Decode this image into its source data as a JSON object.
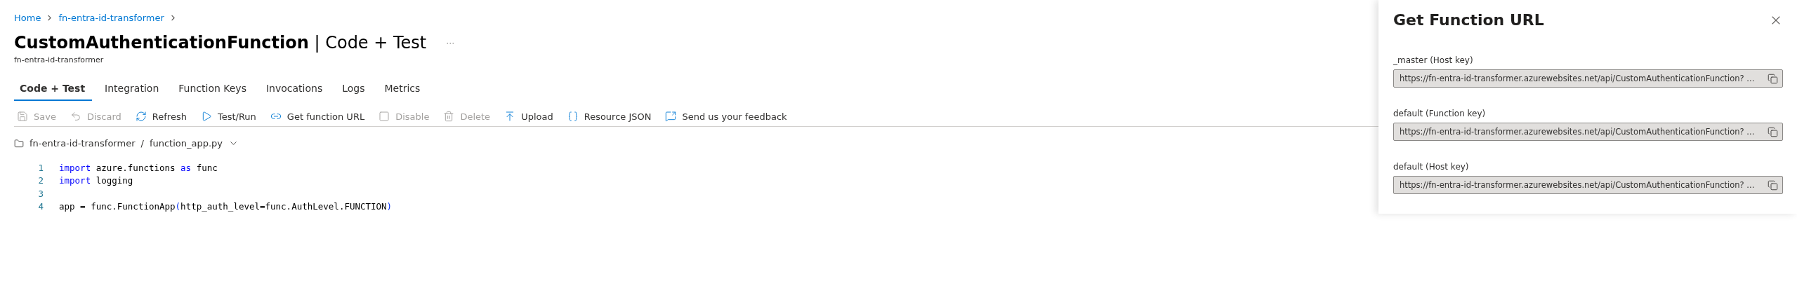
{
  "breadcrumb": [
    {
      "label": "Home"
    },
    {
      "label": "fn-entra-id-transformer"
    }
  ],
  "title": {
    "name": "CustomAuthenticationFunction",
    "separator": "|",
    "section": "Code + Test",
    "more": "···"
  },
  "subtitle": "fn-entra-id-transformer",
  "tabs": [
    {
      "label": "Code + Test",
      "selected": true
    },
    {
      "label": "Integration",
      "selected": false
    },
    {
      "label": "Function Keys",
      "selected": false
    },
    {
      "label": "Invocations",
      "selected": false
    },
    {
      "label": "Logs",
      "selected": false
    },
    {
      "label": "Metrics",
      "selected": false
    }
  ],
  "toolbar": [
    {
      "label": "Save",
      "disabled": true
    },
    {
      "label": "Discard",
      "disabled": true
    },
    {
      "label": "Refresh",
      "disabled": false
    },
    {
      "label": "Test/Run",
      "disabled": false
    },
    {
      "label": "Get function URL",
      "disabled": false
    },
    {
      "label": "Disable",
      "disabled": true
    },
    {
      "label": "Delete",
      "disabled": true
    },
    {
      "label": "Upload",
      "disabled": false
    },
    {
      "label": "Resource JSON",
      "disabled": false
    },
    {
      "label": "Send us your feedback",
      "disabled": false
    }
  ],
  "file_path": {
    "folder": "fn-entra-id-transformer",
    "separator": "/",
    "file": "function_app.py"
  },
  "code": [
    {
      "number": "1",
      "tokens": [
        {
          "kind": "keyword",
          "text": "import"
        },
        {
          "kind": "plain",
          "text": " azure.functions "
        },
        {
          "kind": "keyword",
          "text": "as"
        },
        {
          "kind": "plain",
          "text": " func"
        }
      ]
    },
    {
      "number": "2",
      "tokens": [
        {
          "kind": "keyword",
          "text": "import"
        },
        {
          "kind": "plain",
          "text": " logging"
        }
      ]
    },
    {
      "number": "3"
    },
    {
      "number": "4",
      "tokens": [
        {
          "kind": "plain",
          "text": "app = func.FunctionApp"
        },
        {
          "kind": "paren",
          "text": "("
        },
        {
          "kind": "plain",
          "text": "http_auth_level=func.AuthLevel.FUNCTION"
        },
        {
          "kind": "paren",
          "text": ")"
        }
      ]
    }
  ],
  "panel": {
    "title": "Get Function URL",
    "keys": [
      {
        "label": "_master (Host key)",
        "value": "https://fn-entra-id-transformer.azurewebsites.net/api/CustomAuthenticationFunction? ..."
      },
      {
        "label": "default (Function key)",
        "value": "https://fn-entra-id-transformer.azurewebsites.net/api/CustomAuthenticationFunction? ..."
      },
      {
        "label": "default (Host key)",
        "value": "https://fn-entra-id-transformer.azurewebsites.net/api/CustomAuthenticationFunction? ..."
      }
    ]
  }
}
